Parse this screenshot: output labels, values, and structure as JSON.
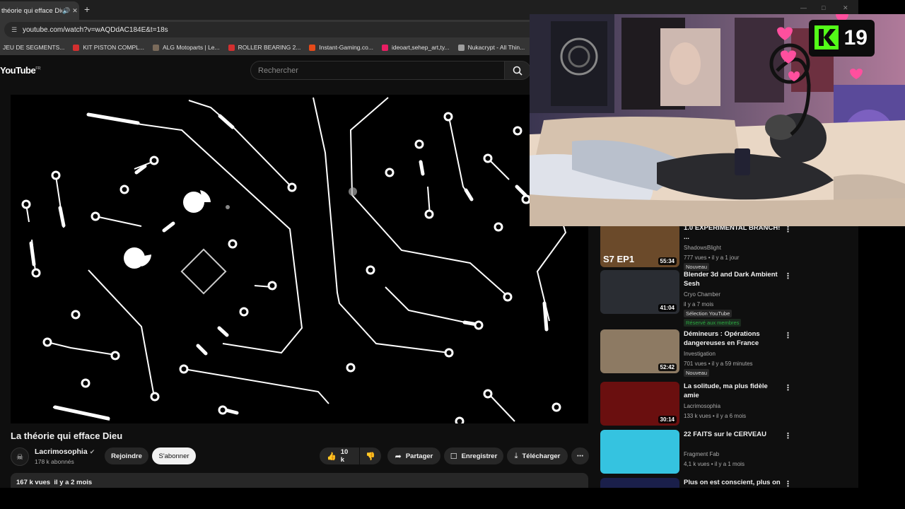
{
  "browser": {
    "tab_title": "théorie qui efface Die",
    "new_tab": "+",
    "url": "youtube.com/watch?v=wAQDdAC184E&t=18s",
    "bookmarks": [
      {
        "label": "JEU DE SEGMENTS...",
        "color": "#444444"
      },
      {
        "label": "KIT PISTON COMPL...",
        "color": "#d32f2f"
      },
      {
        "label": "ALG Motoparts | Le...",
        "color": "#7a6a5a"
      },
      {
        "label": "ROLLER BEARING 2...",
        "color": "#d32f2f"
      },
      {
        "label": "Instant-Gaming.co...",
        "color": "#e64a19"
      },
      {
        "label": "ideoart,sehep_art,ty...",
        "color": "#e91e63"
      },
      {
        "label": "Nukacrypt - All Thin...",
        "color": "#9e9e9e"
      }
    ]
  },
  "youtube": {
    "logo": "YouTube",
    "logo_region": "FR",
    "search_placeholder": "Rechercher",
    "video": {
      "title": "La théorie qui efface Dieu",
      "channel": "Lacrimosophia",
      "subscribers": "178 k abonnés",
      "join_label": "Rejoindre",
      "subscribe_label": "S'abonner",
      "likes": "10 k",
      "share_label": "Partager",
      "save_label": "Enregistrer",
      "download_label": "Télécharger",
      "stats": "167 k vues  il y a 2 mois"
    },
    "recommendations": [
      {
        "title": "1.0 EXPERIMENTAL BRANCH! ...",
        "channel": "ShadowsBlight",
        "meta": "777 vues • il y a 1 jour",
        "badge": "Nouveau",
        "member": "",
        "duration": "55:34",
        "thumb_text": "S7 EP1",
        "thumb_color": "#6b4a2a"
      },
      {
        "title": "Blender 3d and Dark Ambient Sesh",
        "channel": "Cryo Chamber",
        "meta": "il y a 7 mois",
        "badge": "Sélection YouTube",
        "member": "Réservé aux membres",
        "duration": "41:04",
        "thumb_text": "",
        "thumb_color": "#2a2d33"
      },
      {
        "title": "Démineurs : Opérations dangereuses en France",
        "channel": "Investigation",
        "meta": "701 vues • il y a 59 minutes",
        "badge": "Nouveau",
        "member": "",
        "duration": "52:42",
        "thumb_text": "",
        "thumb_color": "#8d7a63"
      },
      {
        "title": "La solitude, ma plus fidèle amie",
        "channel": "Lacrimosophia",
        "meta": "133 k vues • il y a 6 mois",
        "badge": "",
        "member": "",
        "duration": "30:14",
        "thumb_text": "",
        "thumb_color": "#6a0f0f"
      },
      {
        "title": "22 FAITS sur le CERVEAU",
        "channel": "Fragment Fab",
        "meta": "4,1 k vues • il y a 1 mois",
        "badge": "",
        "member": "",
        "duration": "",
        "thumb_text": "",
        "thumb_color": "#35c3e0"
      },
      {
        "title": "Plus on est conscient, plus on",
        "channel": "",
        "meta": "",
        "badge": "",
        "member": "",
        "duration": "",
        "thumb_text": "",
        "thumb_color": "#1a1f4a"
      }
    ]
  },
  "overlay": {
    "counter": "19"
  }
}
